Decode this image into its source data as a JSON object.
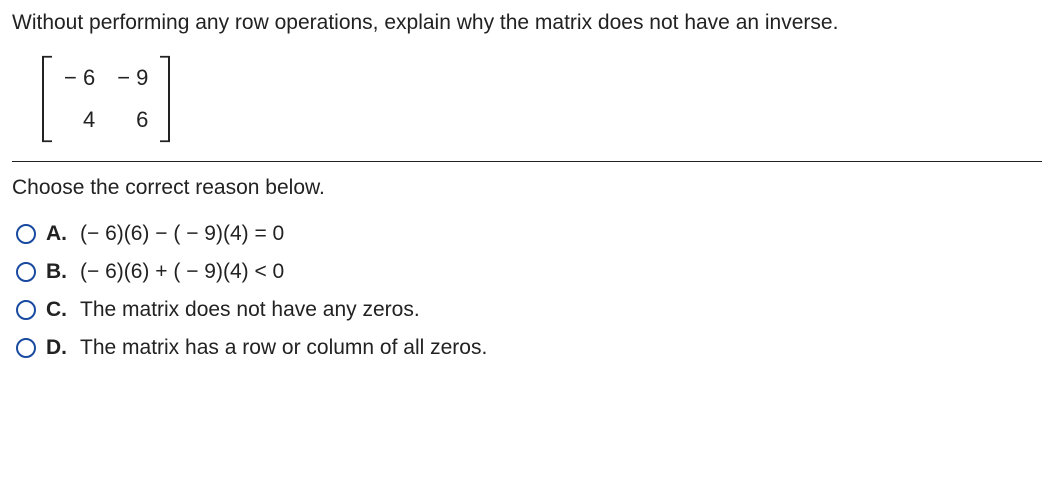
{
  "question": "Without performing any row operations, explain why the matrix does not have an inverse.",
  "matrix": {
    "rows": [
      [
        "− 6",
        "− 9"
      ],
      [
        "4",
        "6"
      ]
    ]
  },
  "prompt": "Choose the correct reason below.",
  "options": [
    {
      "letter": "A.",
      "text": "(− 6)(6) − ( − 9)(4) = 0"
    },
    {
      "letter": "B.",
      "text": "(− 6)(6) + ( − 9)(4)  <  0"
    },
    {
      "letter": "C.",
      "text": "The matrix does not have any zeros."
    },
    {
      "letter": "D.",
      "text": "The matrix has a row or column of all zeros."
    }
  ]
}
